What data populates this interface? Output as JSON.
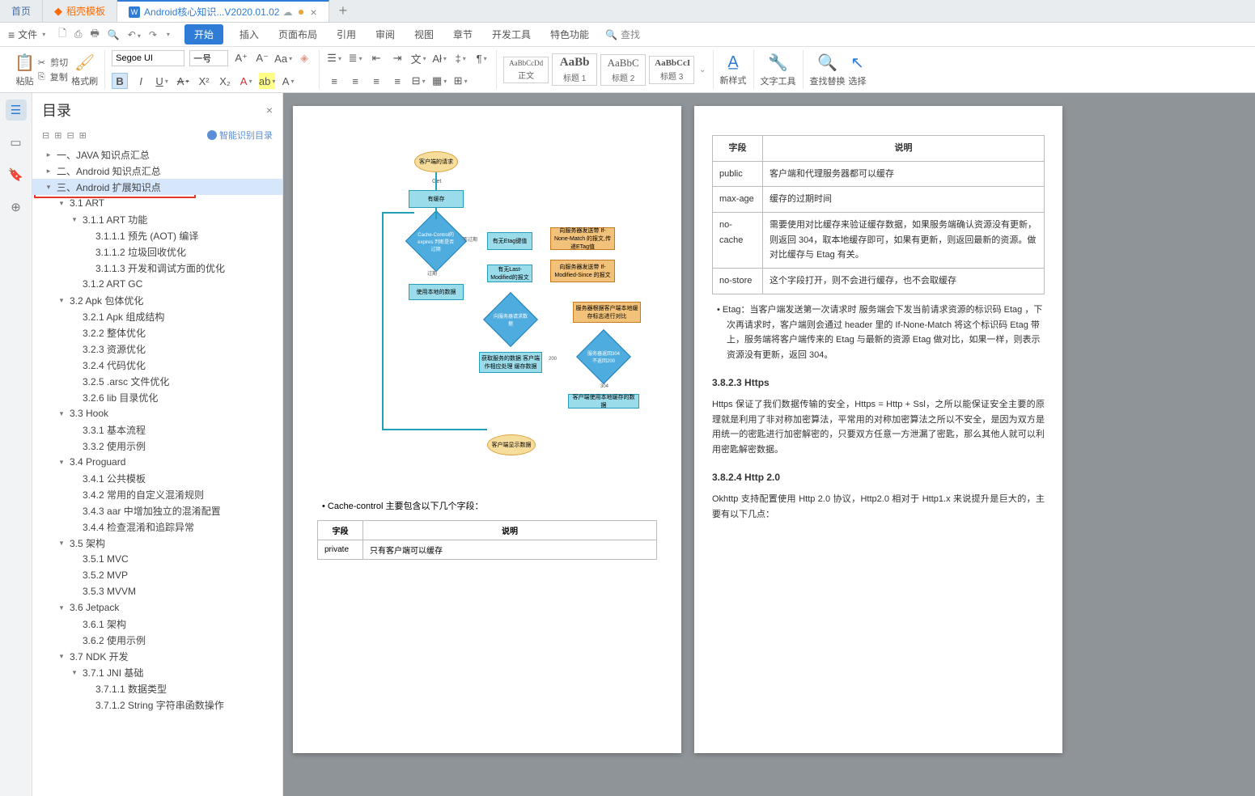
{
  "tabs": {
    "home": "首页",
    "template": "稻壳模板",
    "active": "Android核心知识...V2020.01.02"
  },
  "menubar": {
    "file": "文件",
    "items": [
      "开始",
      "插入",
      "页面布局",
      "引用",
      "审阅",
      "视图",
      "章节",
      "开发工具",
      "特色功能"
    ],
    "search": "查找"
  },
  "ribbon": {
    "paste": "粘贴",
    "cut": "剪切",
    "copy": "复制",
    "format_painter": "格式刷",
    "font_name": "Segoe UI",
    "font_size": "一号",
    "styles": [
      {
        "sample": "AaBbCcDd",
        "label": "正文"
      },
      {
        "sample": "AaBb",
        "label": "标题 1"
      },
      {
        "sample": "AaBbC",
        "label": "标题 2"
      },
      {
        "sample": "AaBbCcI",
        "label": "标题 3"
      }
    ],
    "new_style": "新样式",
    "text_tool": "文字工具",
    "find_replace": "查找替换",
    "select": "选择"
  },
  "outline": {
    "title": "目录",
    "smart": "智能识别目录",
    "items": [
      {
        "indent": 0,
        "arrow": ">",
        "text": "一、JAVA 知识点汇总"
      },
      {
        "indent": 0,
        "arrow": ">",
        "text": "二、Android 知识点汇总"
      },
      {
        "indent": 0,
        "arrow": "v",
        "text": "三、Android 扩展知识点",
        "selected": true
      },
      {
        "indent": 1,
        "arrow": "v",
        "text": "3.1 ART"
      },
      {
        "indent": 2,
        "arrow": "v",
        "text": "3.1.1 ART 功能"
      },
      {
        "indent": 3,
        "arrow": "",
        "text": "3.1.1.1 预先 (AOT) 编译"
      },
      {
        "indent": 3,
        "arrow": "",
        "text": "3.1.1.2 垃圾回收优化"
      },
      {
        "indent": 3,
        "arrow": "",
        "text": "3.1.1.3 开发和调试方面的优化"
      },
      {
        "indent": 2,
        "arrow": "",
        "text": "3.1.2 ART GC"
      },
      {
        "indent": 1,
        "arrow": "v",
        "text": "3.2 Apk 包体优化"
      },
      {
        "indent": 2,
        "arrow": "",
        "text": "3.2.1 Apk 组成结构"
      },
      {
        "indent": 2,
        "arrow": "",
        "text": "3.2.2 整体优化"
      },
      {
        "indent": 2,
        "arrow": "",
        "text": "3.2.3 资源优化"
      },
      {
        "indent": 2,
        "arrow": "",
        "text": "3.2.4 代码优化"
      },
      {
        "indent": 2,
        "arrow": "",
        "text": "3.2.5 .arsc 文件优化"
      },
      {
        "indent": 2,
        "arrow": "",
        "text": "3.2.6 lib 目录优化"
      },
      {
        "indent": 1,
        "arrow": "v",
        "text": "3.3 Hook"
      },
      {
        "indent": 2,
        "arrow": "",
        "text": "3.3.1 基本流程"
      },
      {
        "indent": 2,
        "arrow": "",
        "text": "3.3.2 使用示例"
      },
      {
        "indent": 1,
        "arrow": "v",
        "text": "3.4 Proguard"
      },
      {
        "indent": 2,
        "arrow": "",
        "text": "3.4.1 公共模板"
      },
      {
        "indent": 2,
        "arrow": "",
        "text": "3.4.2 常用的自定义混淆规则"
      },
      {
        "indent": 2,
        "arrow": "",
        "text": "3.4.3 aar 中增加独立的混淆配置"
      },
      {
        "indent": 2,
        "arrow": "",
        "text": "3.4.4 检查混淆和追踪异常"
      },
      {
        "indent": 1,
        "arrow": "v",
        "text": "3.5 架构"
      },
      {
        "indent": 2,
        "arrow": "",
        "text": "3.5.1 MVC"
      },
      {
        "indent": 2,
        "arrow": "",
        "text": "3.5.2 MVP"
      },
      {
        "indent": 2,
        "arrow": "",
        "text": "3.5.3 MVVM"
      },
      {
        "indent": 1,
        "arrow": "v",
        "text": "3.6 Jetpack"
      },
      {
        "indent": 2,
        "arrow": "",
        "text": "3.6.1 架构"
      },
      {
        "indent": 2,
        "arrow": "",
        "text": "3.6.2 使用示例"
      },
      {
        "indent": 1,
        "arrow": "v",
        "text": "3.7 NDK 开发"
      },
      {
        "indent": 2,
        "arrow": "v",
        "text": "3.7.1 JNI 基础"
      },
      {
        "indent": 3,
        "arrow": "",
        "text": "3.7.1.1 数据类型"
      },
      {
        "indent": 3,
        "arrow": "",
        "text": "3.7.1.2 String 字符串函数操作"
      }
    ]
  },
  "doc_left": {
    "bullet": "Cache-control 主要包含以下几个字段：",
    "table": {
      "h1": "字段",
      "h2": "说明",
      "r1f": "private",
      "r1d": "只有客户端可以缓存"
    }
  },
  "doc_right": {
    "table_header": {
      "field": "字段",
      "desc": "说明"
    },
    "rows": [
      {
        "f": "public",
        "d": "客户端和代理服务器都可以缓存"
      },
      {
        "f": "max-age",
        "d": "缓存的过期时间"
      },
      {
        "f": "no-cache",
        "d": "需要使用对比缓存来验证缓存数据，如果服务端确认资源没有更新，则返回 304，取本地缓存即可，如果有更新，则返回最新的资源。做对比缓存与 Etag 有关。"
      },
      {
        "f": "no-store",
        "d": "这个字段打开，则不会进行缓存，也不会取缓存"
      }
    ],
    "etag_bullet": "Etag：当客户端发送第一次请求时 服务端会下发当前请求资源的标识码 Etag ，下次再请求时，客户端则会通过 header 里的 If-None-Match 将这个标识码 Etag 带上，服务端将客户端传来的 Etag 与最新的资源 Etag 做对比，如果一样，则表示资源没有更新，返回 304。",
    "h_https": "3.8.2.3 Https",
    "p_https": "Https 保证了我们数据传输的安全，Https = Http + Ssl，之所以能保证安全主要的原理就是利用了非对称加密算法，平常用的对称加密算法之所以不安全，是因为双方是用统一的密匙进行加密解密的，只要双方任意一方泄漏了密匙，那么其他人就可以利用密匙解密数据。",
    "h_http2": "3.8.2.4 Http 2.0",
    "p_http2": "Okhttp 支持配置使用 Http 2.0 协议，Http2.0 相对于 Http1.x 来说提升是巨大的，主要有以下几点："
  },
  "flowchart": {
    "start": "客户端的请求",
    "get": "Get",
    "has_cache": "有缓存",
    "cc_expires": "Cache-Control的expires 判断是否过期",
    "n_expired": "不过期",
    "has_etag": "有无Etag键值",
    "send_match": "向服务器发送带 If-None-Match 的报文,传递ETag值",
    "expired": "过期",
    "has_lm": "有无Last-Modified的报文",
    "send_since": "向服务器发送带 If-Modified-Since 的报文",
    "use_local": "使用本地的数据",
    "req_server": "向服务器请求数据",
    "server_diff": "服务器根据客户端本地缓存标志进行对比",
    "update_cache": "获取服务的数据 客户端作相应处理 缓存数据",
    "code200": "200",
    "return304": "服务器返回304 不返回200",
    "code304": "304",
    "use_cache": "客户端使用本地缓存的数据",
    "show": "客户端显示数据"
  }
}
